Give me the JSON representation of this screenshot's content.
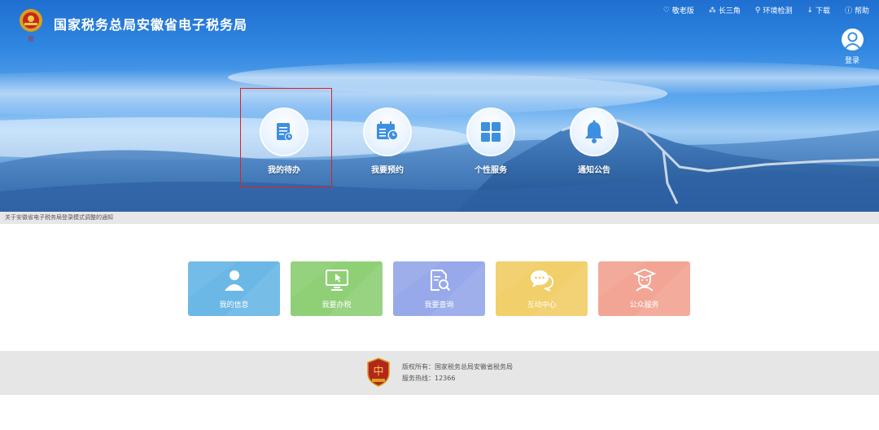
{
  "header": {
    "site_title": "国家税务总局安徽省电子税务局",
    "logo_icon": "tax-emblem-icon",
    "top_links": [
      {
        "label": "敬老版",
        "icon": "elder-icon"
      },
      {
        "label": "长三角",
        "icon": "network-icon"
      },
      {
        "label": "环境检测",
        "icon": "wrench-icon"
      },
      {
        "label": "下载",
        "icon": "download-icon"
      },
      {
        "label": "帮助",
        "icon": "help-icon"
      }
    ],
    "login_label": "登录"
  },
  "hero": {
    "items": [
      {
        "label": "我的待办",
        "icon": "todo-document-icon"
      },
      {
        "label": "我要预约",
        "icon": "calendar-clock-icon"
      },
      {
        "label": "个性服务",
        "icon": "grid-icon"
      },
      {
        "label": "通知公告",
        "icon": "bell-icon"
      }
    ]
  },
  "notice": {
    "text": "关于安徽省电子税务局登录模式调整的通知"
  },
  "tiles": [
    {
      "label": "我的信息",
      "icon": "user-icon",
      "color": "#6bb8e6"
    },
    {
      "label": "我要办税",
      "icon": "monitor-cursor-icon",
      "color": "#8fd076"
    },
    {
      "label": "我要查询",
      "icon": "document-search-icon",
      "color": "#97a9ea"
    },
    {
      "label": "互动中心",
      "icon": "chat-icon",
      "color": "#f1cf6a"
    },
    {
      "label": "公众服务",
      "icon": "service-agent-icon",
      "color": "#f2a594"
    }
  ],
  "footer": {
    "copyright": "版权所有：国家税务总局安徽省税务局",
    "hotline": "服务热线：12366",
    "logo_icon": "tax-shield-icon"
  },
  "colors": {
    "highlight_border": "#e02020",
    "hero_icon_blue": "#3d8fe0"
  }
}
